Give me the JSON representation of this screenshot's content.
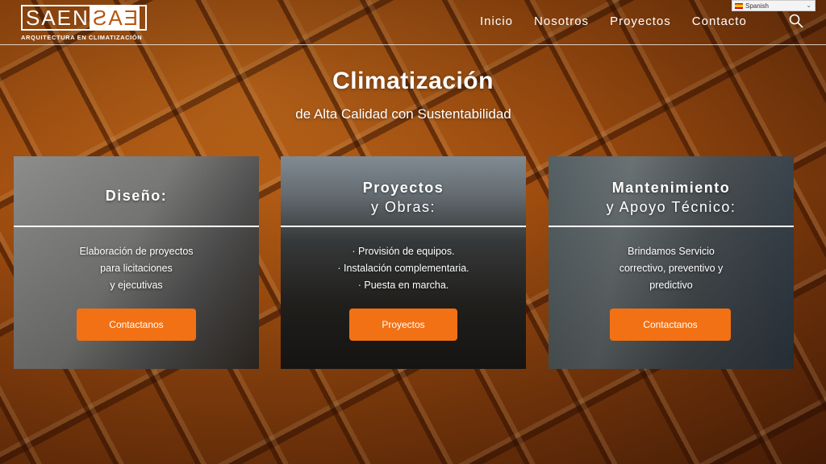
{
  "header": {
    "logo_text_left": "SAEN",
    "logo_text_mirrored": "EAS",
    "logo_tagline": "ARQUITECTURA EN CLIMATIZACIÓN",
    "nav": [
      "Inicio",
      "Nosotros",
      "Proyectos",
      "Contacto"
    ],
    "language": "Spanish"
  },
  "hero": {
    "title": "Climatización",
    "subtitle": "de Alta Calidad con Sustentabilidad"
  },
  "cards": [
    {
      "title_line1": "Diseño:",
      "title_line2": "",
      "text": [
        "Elaboración de proyectos",
        "para licitaciones",
        "y ejecutivas"
      ],
      "button": "Contactanos"
    },
    {
      "title_line1": "Proyectos",
      "title_line2": "y Obras:",
      "text": [
        "· Provisión de equipos.",
        "· Instalación complementaria.",
        "· Puesta en marcha."
      ],
      "button": "Proyectos"
    },
    {
      "title_line1": "Mantenimiento",
      "title_line2": "y Apoyo Técnico:",
      "text": [
        "Brindamos Servicio",
        "correctivo, preventivo y",
        "predictivo"
      ],
      "button": "Contactanos"
    }
  ],
  "colors": {
    "accent": "#f27114",
    "background_tint": "#b85a12"
  }
}
